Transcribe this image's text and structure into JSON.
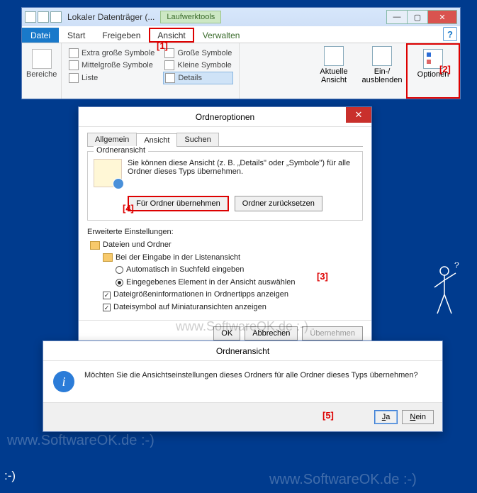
{
  "explorer": {
    "title": "Lokaler Datenträger (...",
    "tools_tab": "Laufwerktools",
    "tabs": {
      "file": "Datei",
      "start": "Start",
      "share": "Freigeben",
      "view": "Ansicht",
      "manage": "Verwalten"
    },
    "ribbon": {
      "bereiche": "Bereiche",
      "views": {
        "xl": "Extra große Symbole",
        "large": "Große Symbole",
        "medium": "Mittelgroße Symbole",
        "small": "Kleine Symbole",
        "list": "Liste",
        "details": "Details"
      },
      "current_view": "Aktuelle Ansicht",
      "show_hide": "Ein-/ ausblenden",
      "options": "Optionen"
    }
  },
  "annotations": {
    "a1": "[1]",
    "a2": "[2]",
    "a3": "[3]",
    "a4": "[4]",
    "a5": "[5]"
  },
  "dlg_options": {
    "title": "Ordneroptionen",
    "tabs": {
      "general": "Allgemein",
      "view": "Ansicht",
      "search": "Suchen"
    },
    "folder_view": {
      "legend": "Ordneransicht",
      "text": "Sie können diese Ansicht (z. B. „Details\" oder „Symbole\") für alle Ordner dieses Typs übernehmen.",
      "apply": "Für Ordner übernehmen",
      "reset": "Ordner zurücksetzen"
    },
    "advanced": {
      "legend": "Erweiterte Einstellungen:",
      "root": "Dateien und Ordner",
      "typing": "Bei der Eingabe in der Listenansicht",
      "opt_search": "Automatisch in Suchfeld eingeben",
      "opt_select": "Eingegebenes Element in der Ansicht auswählen",
      "chk_size": "Dateigrößeninformationen in Ordnertipps anzeigen",
      "chk_thumb": "Dateisymbol auf Miniaturansichten anzeigen"
    },
    "buttons": {
      "ok": "OK",
      "cancel": "Abbrechen",
      "apply": "Übernehmen"
    }
  },
  "dlg_msg": {
    "title": "Ordneransicht",
    "text": "Möchten Sie die Ansichtseinstellungen dieses Ordners für alle Ordner dieses Typs übernehmen?",
    "yes": "Ja",
    "no": "Nein"
  },
  "watermark": "www.SoftwareOK.de  :-)"
}
